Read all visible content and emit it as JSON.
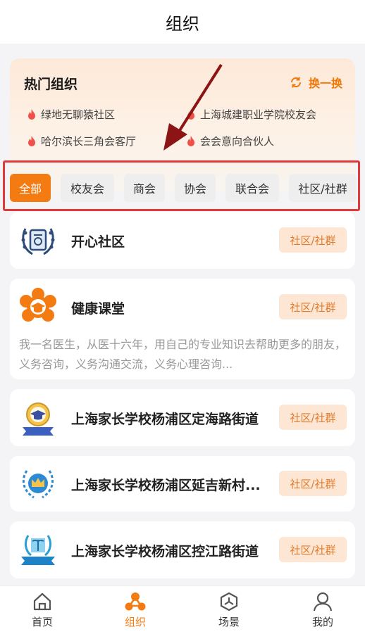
{
  "header": {
    "title": "组织"
  },
  "hot": {
    "title": "热门组织",
    "refresh_label": "换一换",
    "items": [
      "绿地无聊猿社区",
      "上海城建职业学院校友会",
      "哈尔滨长三角会客厅",
      "会会意向合伙人"
    ]
  },
  "filters": [
    "全部",
    "校友会",
    "商会",
    "协会",
    "联合会",
    "社区/社群"
  ],
  "orgs": [
    {
      "name": "开心社区",
      "tag": "社区/社群",
      "logo": "laurel-badge-icon"
    },
    {
      "name": "健康课堂",
      "tag": "社区/社群",
      "logo": "flower-graduation-cap-icon",
      "desc": "我一名医生，从医十六年，用自己的专业知识去帮助更多的朋友，义务咨询，义务沟通交流，义务心理咨询..."
    },
    {
      "name": "上海家长学校杨浦区定海路街道",
      "tag": "社区/社群",
      "logo": "graduation-cap-badge-icon"
    },
    {
      "name": "上海家长学校杨浦区延吉新村...",
      "tag": "社区/社群",
      "logo": "crown-laurel-icon"
    },
    {
      "name": "上海家长学校杨浦区控江路街道",
      "tag": "社区/社群",
      "logo": "book-ribbon-icon"
    }
  ],
  "tabbar": [
    {
      "label": "首页",
      "icon": "home-icon"
    },
    {
      "label": "组织",
      "icon": "organization-icon"
    },
    {
      "label": "场景",
      "icon": "scene-icon"
    },
    {
      "label": "我的",
      "icon": "profile-icon"
    }
  ],
  "colors": {
    "accent": "#f47a12",
    "tag_bg": "#fde6d3",
    "tag_text": "#e27a2b",
    "highlight_box": "#e13a3a"
  }
}
